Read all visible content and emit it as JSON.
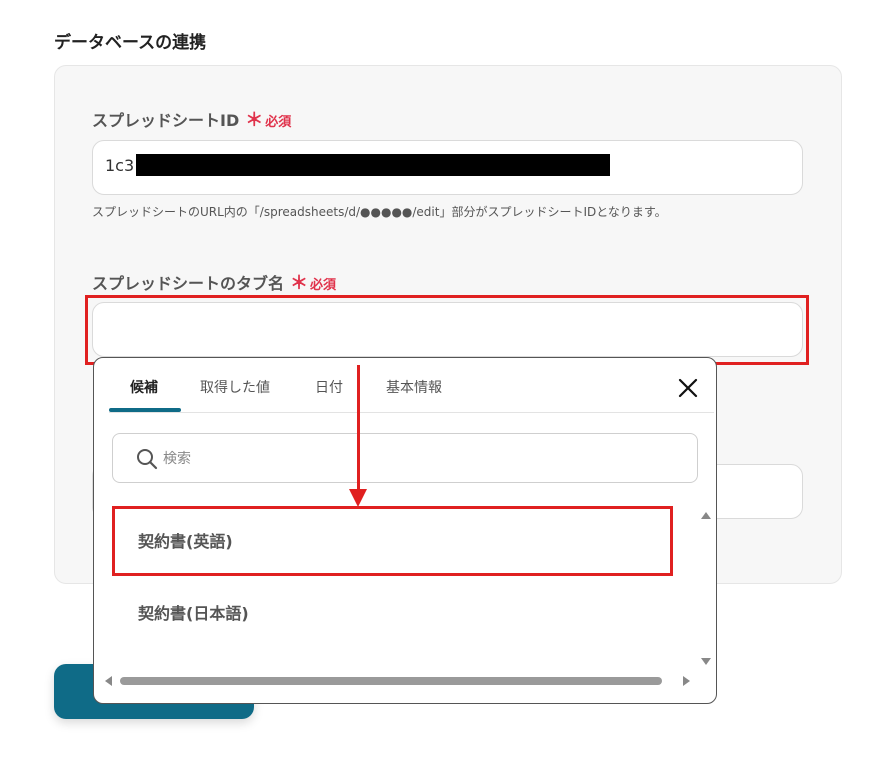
{
  "section": {
    "title": "データベースの連携"
  },
  "spreadsheet_id": {
    "label": "スプレッドシートID",
    "required_mark": "＊",
    "required_text": "必須",
    "value": "1c3",
    "help": "スプレッドシートのURL内の「/spreadsheets/d/●●●●●/edit」部分がスプレッドシートIDとなります。"
  },
  "tab_name": {
    "label": "スプレッドシートのタブ名",
    "required_mark": "＊",
    "required_text": "必須",
    "value": ""
  },
  "dropdown": {
    "tabs": [
      {
        "label": "候補"
      },
      {
        "label": "取得した値"
      },
      {
        "label": "日付"
      },
      {
        "label": "基本情報"
      }
    ],
    "search_placeholder": "検索",
    "options": [
      {
        "label": "契約書(英語)"
      },
      {
        "label": "契約書(日本語)"
      }
    ]
  },
  "colors": {
    "accent": "#0f6b87",
    "required": "#e0324b",
    "highlight": "#e02020"
  }
}
